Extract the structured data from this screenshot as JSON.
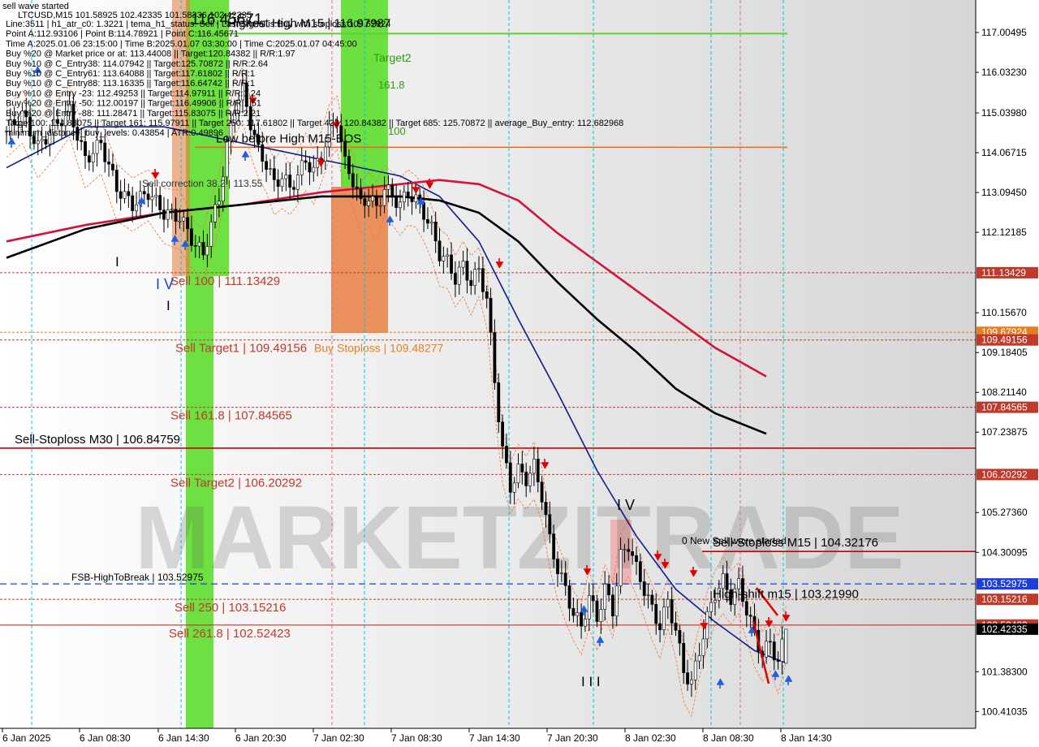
{
  "chart": {
    "symbol_line": "LTCUSD,M15   101.58925 102.42335 101.58336 102.42335",
    "watermark": "MARKETZITRADE",
    "top_left_label": "sell wave started"
  },
  "info_lines": [
    "Line:3511 | h1_atr_c0: 1.3221 | tema_h1_status: Sell  | Last Signal is:Buy with stoploss:109.67924",
    "Point A:112.93106 | Point B:114.78921 | Point C:116.45671",
    "Time A:2025.01.06 23:15:00 | Time B:2025.01.07 03:30:00 | Time C:2025.01.07 04:45:00",
    "Buy %20 @ Market price or at: 113.44008 || Target:120.84382 || R/R:1.97",
    "Buy %10 @ C_Entry38: 114.07942 || Target:125.70872 || R/R:2.64",
    "Buy %10 @ C_Entry61: 113.64088 || Target:117.61802 || R/R:1",
    "Buy %10 @ C_Entry88: 113.16335 || Target:116.64742 || R/R:1",
    "Buy %10 @ Entry -23: 112.49253 || Target:114.97911 || R/R:1.24",
    "Buy %20 @ Entry -50: 112.00197 || Target:116.49906 || R/R:1.51",
    "Buy %20 @ Entry -88: 111.28471 || Target:115.83075 || R/R:2.21",
    "Target100: 114.83075 || Target 161: 115.97911 || Target 250: 117.61802 || Target 423: 120.84382 || Target 685: 125.70872 || average_Buy_entry: 112.682968",
    "minimum_distance_buy_levels: 0.43854 | ATR:0.49896"
  ],
  "price_axis": {
    "ticks": [
      "117.00495",
      "116.03230",
      "115.03980",
      "114.06715",
      "113.09450",
      "112.12185",
      "110.15670",
      "109.18405",
      "108.21140",
      "107.23875",
      "105.27360",
      "104.30095",
      "101.38300",
      "100.41035"
    ],
    "badges": [
      {
        "label": "111.13429",
        "color": "#c0392b"
      },
      {
        "label": "109.67924",
        "color": "#e67e22"
      },
      {
        "label": "109.49156",
        "color": "#c0392b"
      },
      {
        "label": "107.84565",
        "color": "#c0392b"
      },
      {
        "label": "106.20292",
        "color": "#c0392b"
      },
      {
        "label": "103.52975",
        "color": "#1f3ddb"
      },
      {
        "label": "103.15216",
        "color": "#c0392b"
      },
      {
        "label": "102.52423",
        "color": "#c0392b"
      },
      {
        "label": "102.42335",
        "color": "#000000"
      }
    ]
  },
  "time_axis": {
    "ticks": [
      "6 Jan 2025",
      "6 Jan 08:30",
      "6 Jan 14:30",
      "6 Jan 20:30",
      "7 Jan 02:30",
      "7 Jan 08:30",
      "7 Jan 14:30",
      "7 Jan 20:30",
      "8 Jan 02:30",
      "8 Jan 08:30",
      "8 Jan 14:30"
    ]
  },
  "annotations": {
    "sell_100": "Sell 100 | 111.13429",
    "sell_target1": "Sell Target1 | 109.49156",
    "buy_stoploss": "Buy Stoploss | 109.48277",
    "sell_161": "Sell 161.8 | 107.84565",
    "sell_stoploss_m30": "Sell-Stoploss M30 | 106.84759",
    "sell_target2": "Sell Target2 | 106.20292",
    "fsb": "FSB-HighToBreak | 103.52975",
    "sell_250": "Sell  250 | 103.15216",
    "sell_2618": "Sell  261.8 | 102.52423",
    "sell_stoploss_m15": "Sell-Stoploss M15 | 104.32176",
    "high_shift": "High-shift m15 | 103.21990",
    "highest_high": "Highest High   M15 | 116.97987",
    "low_before_high": "Low before High   M15-BOS",
    "new_sell_wave": "0 New Sell wave started",
    "target2": "Target2",
    "level_1618": "161.8",
    "level_100": "100",
    "sell_correction_382": "Sell correction 38.2 | 113.55",
    "wave_i": "I",
    "wave_iv_left": "I V",
    "wave_i2": "I",
    "wave_iii": "I I I",
    "wave_iv_right": "I V",
    "point_c_label": "116.45671"
  },
  "colors": {
    "ema_blue": "#0d1a8c",
    "ma_red": "#d2143c",
    "ma_black": "#000000",
    "candle": "#000000",
    "sell_red": "#c0392b",
    "green_zone": "#55dd22",
    "orange_zone": "#e8793a",
    "cyan_grid": "#00c8d8",
    "pink_grid": "#e07090"
  },
  "chart_data": {
    "type": "candlestick",
    "symbol": "LTCUSD",
    "timeframe": "M15",
    "ohlc_last": {
      "open": 101.58925,
      "high": 102.42335,
      "low": 101.58336,
      "close": 102.42335
    },
    "y_range": [
      100.0,
      117.8
    ],
    "x_categories": [
      "6 Jan 2025",
      "6 Jan 08:30",
      "6 Jan 14:30",
      "6 Jan 20:30",
      "7 Jan 02:30",
      "7 Jan 08:30",
      "7 Jan 14:30",
      "7 Jan 20:30",
      "8 Jan 02:30",
      "8 Jan 08:30",
      "8 Jan 14:30"
    ],
    "close_path": [
      [
        0,
        114.6
      ],
      [
        4,
        115.0
      ],
      [
        8,
        114.2
      ],
      [
        12,
        114.7
      ],
      [
        16,
        115.1
      ],
      [
        20,
        113.9
      ],
      [
        24,
        114.3
      ],
      [
        28,
        113.2
      ],
      [
        32,
        112.8
      ],
      [
        36,
        113.1
      ],
      [
        40,
        112.6
      ],
      [
        44,
        112.5
      ],
      [
        48,
        111.8
      ],
      [
        50,
        111.6
      ],
      [
        52,
        112.3
      ],
      [
        54,
        113.0
      ],
      [
        56,
        114.2
      ],
      [
        58,
        115.2
      ],
      [
        60,
        115.6
      ],
      [
        62,
        114.8
      ],
      [
        64,
        114.1
      ],
      [
        66,
        113.8
      ],
      [
        68,
        113.3
      ],
      [
        70,
        113.5
      ],
      [
        72,
        113.2
      ],
      [
        74,
        113.5
      ],
      [
        76,
        113.9
      ],
      [
        78,
        113.6
      ],
      [
        80,
        114.0
      ],
      [
        82,
        114.6
      ],
      [
        84,
        114.9
      ],
      [
        86,
        113.8
      ],
      [
        88,
        113.4
      ],
      [
        90,
        112.8
      ],
      [
        92,
        113.0
      ],
      [
        94,
        112.7
      ],
      [
        96,
        113.2
      ],
      [
        98,
        113.0
      ],
      [
        100,
        112.8
      ],
      [
        102,
        113.1
      ],
      [
        104,
        112.9
      ],
      [
        106,
        112.6
      ],
      [
        108,
        112.2
      ],
      [
        110,
        111.6
      ],
      [
        112,
        111.4
      ],
      [
        114,
        111.0
      ],
      [
        116,
        111.3
      ],
      [
        118,
        110.9
      ],
      [
        120,
        111.2
      ],
      [
        122,
        110.5
      ],
      [
        124,
        108.5
      ],
      [
        126,
        106.8
      ],
      [
        128,
        105.9
      ],
      [
        130,
        106.3
      ],
      [
        132,
        106.1
      ],
      [
        134,
        106.4
      ],
      [
        136,
        105.7
      ],
      [
        138,
        104.6
      ],
      [
        140,
        103.9
      ],
      [
        142,
        103.4
      ],
      [
        144,
        102.8
      ],
      [
        146,
        102.5
      ],
      [
        148,
        103.2
      ],
      [
        150,
        102.7
      ],
      [
        152,
        103.4
      ],
      [
        154,
        102.9
      ],
      [
        156,
        104.2
      ],
      [
        158,
        104.5
      ],
      [
        160,
        103.9
      ],
      [
        162,
        103.4
      ],
      [
        164,
        102.9
      ],
      [
        166,
        102.5
      ],
      [
        168,
        103.1
      ],
      [
        170,
        102.4
      ],
      [
        172,
        101.4
      ],
      [
        174,
        101.1
      ],
      [
        176,
        101.9
      ],
      [
        178,
        102.7
      ],
      [
        180,
        103.3
      ],
      [
        182,
        103.6
      ],
      [
        184,
        103.2
      ],
      [
        186,
        103.5
      ],
      [
        188,
        102.9
      ],
      [
        190,
        102.3
      ],
      [
        192,
        101.8
      ],
      [
        194,
        102.1
      ],
      [
        196,
        101.6
      ],
      [
        198,
        102.42
      ]
    ],
    "series": [
      {
        "name": "ema_fast",
        "type": "line",
        "points": [
          [
            0,
            113.7
          ],
          [
            20,
            114.7
          ],
          [
            40,
            114.7
          ],
          [
            60,
            114.3
          ],
          [
            80,
            113.9
          ],
          [
            100,
            113.5
          ],
          [
            110,
            113.0
          ],
          [
            120,
            111.9
          ],
          [
            130,
            110.0
          ],
          [
            140,
            108.2
          ],
          [
            150,
            106.3
          ],
          [
            160,
            104.7
          ],
          [
            170,
            103.4
          ],
          [
            180,
            102.6
          ],
          [
            190,
            101.9
          ],
          [
            198,
            101.6
          ]
        ]
      },
      {
        "name": "ma_red",
        "type": "line",
        "points": [
          [
            0,
            111.9
          ],
          [
            20,
            112.3
          ],
          [
            40,
            112.6
          ],
          [
            60,
            112.8
          ],
          [
            80,
            113.1
          ],
          [
            100,
            113.3
          ],
          [
            110,
            113.4
          ],
          [
            120,
            113.3
          ],
          [
            130,
            112.9
          ],
          [
            140,
            112.1
          ],
          [
            150,
            111.4
          ],
          [
            160,
            110.7
          ],
          [
            170,
            110.0
          ],
          [
            180,
            109.3
          ],
          [
            193,
            108.6
          ]
        ]
      },
      {
        "name": "ma_black",
        "type": "line",
        "points": [
          [
            0,
            111.5
          ],
          [
            20,
            112.2
          ],
          [
            40,
            112.6
          ],
          [
            60,
            112.8
          ],
          [
            80,
            113.0
          ],
          [
            100,
            113.0
          ],
          [
            110,
            112.9
          ],
          [
            120,
            112.6
          ],
          [
            130,
            111.9
          ],
          [
            140,
            110.9
          ],
          [
            150,
            110.0
          ],
          [
            160,
            109.2
          ],
          [
            170,
            108.3
          ],
          [
            180,
            107.7
          ],
          [
            193,
            107.2
          ]
        ]
      }
    ],
    "levels": [
      {
        "label": "Highest High M15",
        "value": 116.97987
      },
      {
        "label": "Low before High M15-BOS",
        "value": 114.2
      },
      {
        "label": "Sell 100",
        "value": 111.13429
      },
      {
        "label": "Buy Stoploss",
        "value": 109.67924
      },
      {
        "label": "Sell Target1",
        "value": 109.49156
      },
      {
        "label": "Sell 161.8",
        "value": 107.84565
      },
      {
        "label": "Sell-Stoploss M30",
        "value": 106.84759
      },
      {
        "label": "Sell Target2",
        "value": 106.20292
      },
      {
        "label": "Sell-Stoploss M15",
        "value": 104.32176
      },
      {
        "label": "FSB-HighToBreak",
        "value": 103.52975
      },
      {
        "label": "High-shift m15",
        "value": 103.2199
      },
      {
        "label": "Sell 250",
        "value": 103.15216
      },
      {
        "label": "Sell 261.8",
        "value": 102.52423
      }
    ]
  }
}
